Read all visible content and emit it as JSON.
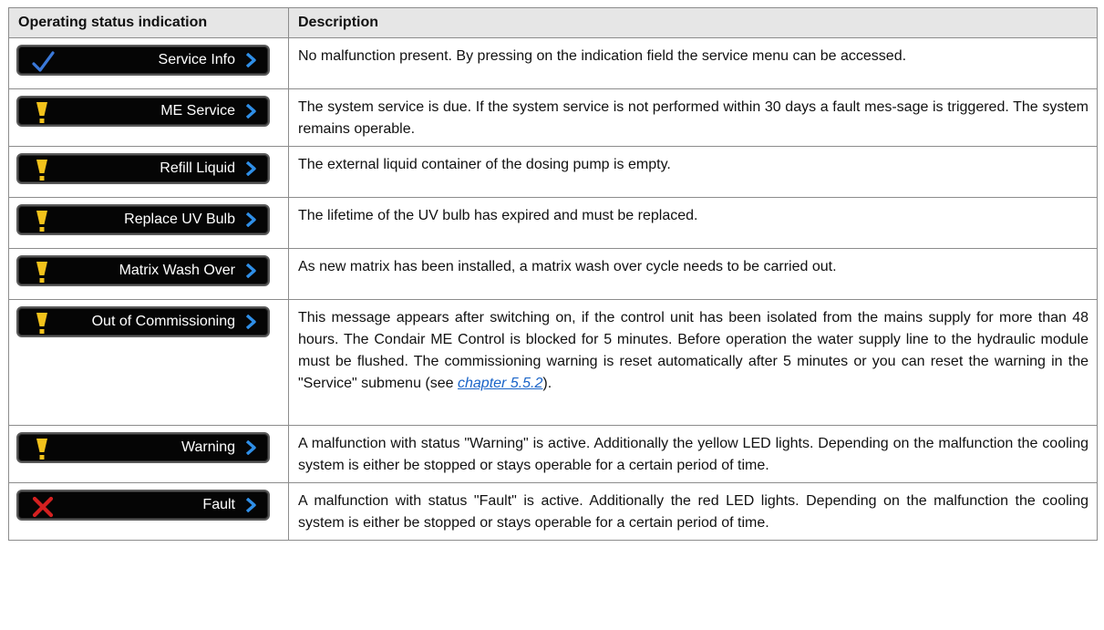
{
  "table": {
    "headers": [
      "Operating status indication",
      "Description"
    ],
    "rows": [
      {
        "label": "Service Info",
        "icon": "checkmark-icon",
        "row_id": "service-info",
        "desc": "No malfunction present. By pressing on the indication field the service menu can be accessed."
      },
      {
        "label": "ME Service",
        "icon": "warning-exclamation-icon",
        "row_id": "me-service",
        "desc": "The system service is due. If the system service is not performed within 30 days a fault mes-sage is triggered. The system remains operable."
      },
      {
        "label": "Refill Liquid",
        "icon": "warning-exclamation-icon",
        "row_id": "refill-liquid",
        "desc": "The external liquid container of the dosing pump is empty."
      },
      {
        "label": "Replace UV Bulb",
        "icon": "warning-exclamation-icon",
        "row_id": "replace-uv-bulb",
        "desc": "The lifetime of the UV bulb has expired and must be replaced."
      },
      {
        "label": "Matrix Wash Over",
        "icon": "warning-exclamation-icon",
        "row_id": "matrix-wash-over",
        "desc": "As new matrix has been installed, a matrix wash over cycle needs to be carried out."
      },
      {
        "label": "Out of Commissioning",
        "icon": "warning-exclamation-icon",
        "row_id": "out-of-commissioning",
        "desc": "This message appears after switching on, if the control unit has been isolated from the mains supply for more than 48 hours. The Condair ME Control is blocked for 5 minutes. Before operation the water supply line to the hydraulic module must be flushed. The commissioning warning is reset automatically after 5 minutes or you can reset the warning in the \"Service\" submenu (see ",
        "link": "chapter 5.5.2",
        "desc_end": ")."
      },
      {
        "label": "Warning",
        "icon": "warning-exclamation-icon",
        "row_id": "warning",
        "desc": "A malfunction with status \"Warning\" is active. Additionally the yellow LED lights. Depending on the malfunction the cooling system is either be stopped or stays operable for a certain period of time."
      },
      {
        "label": "Fault",
        "icon": "fault-x-icon",
        "row_id": "fault",
        "desc": "A malfunction with status \"Fault\" is active. Additionally the red LED lights. Depending on the malfunction the cooling system is either be stopped or stays operable for a certain period of time."
      }
    ]
  },
  "colors": {
    "button_bg": "#050505",
    "chevron": "#2f8fe8",
    "check": "#3a78d8",
    "warning": "#f3c21b",
    "fault": "#d42020",
    "link": "#1a64c8"
  }
}
